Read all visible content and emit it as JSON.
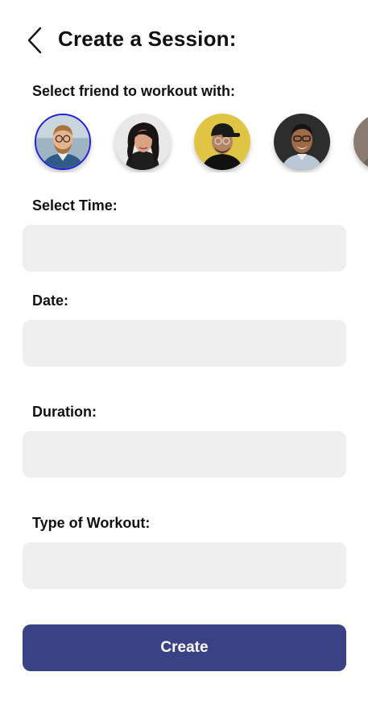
{
  "header": {
    "title": "Create a Session:",
    "back_icon": "chevron-left-icon"
  },
  "friends": {
    "label": "Select friend to workout with:",
    "selected_index": 0,
    "items": [
      {
        "avatar": "avatar-photo-man-glasses-beard",
        "selected": true
      },
      {
        "avatar": "avatar-photo-woman-dark-hair",
        "selected": false
      },
      {
        "avatar": "avatar-photo-man-cap-yellow-bg",
        "selected": false
      },
      {
        "avatar": "avatar-photo-man-glasses-smiling",
        "selected": false
      },
      {
        "avatar": "avatar-photo-partial",
        "selected": false
      }
    ]
  },
  "form": {
    "time_label": "Select Time:",
    "time_value": "",
    "date_label": "Date:",
    "date_value": "",
    "duration_label": "Duration:",
    "duration_value": "",
    "workout_label": "Type of Workout:",
    "workout_value": ""
  },
  "actions": {
    "create_label": "Create"
  },
  "colors": {
    "accent": "#3b4185",
    "selected_ring": "#1f1fd6",
    "field_bg": "#efefef"
  }
}
